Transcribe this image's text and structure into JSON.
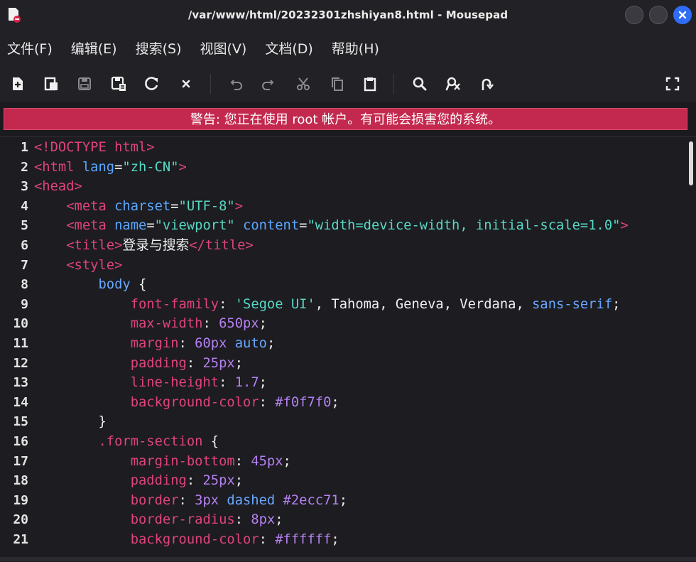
{
  "window": {
    "title": "/var/www/html/20232301zhshiyan8.html - Mousepad",
    "close_color": "#2f6df6"
  },
  "menu": [
    "文件(F)",
    "编辑(E)",
    "搜索(S)",
    "视图(V)",
    "文档(D)",
    "帮助(H)"
  ],
  "toolbar": {
    "icons": [
      "new-document-icon",
      "new-window-icon",
      "save-icon",
      "save-as-icon",
      "reload-icon",
      "close-tab-icon",
      "undo-icon",
      "redo-icon",
      "cut-icon",
      "copy-icon",
      "paste-icon",
      "search-icon",
      "replace-icon",
      "goto-line-icon",
      "fullscreen-icon"
    ]
  },
  "warning": {
    "text": "警告: 您正在使用 root 帐户。有可能会损害您的系统。",
    "color": "#c3294e"
  },
  "editor": {
    "line_numbers": [
      "1",
      "2",
      "3",
      "4",
      "5",
      "6",
      "7",
      "8",
      "9",
      "10",
      "11",
      "12",
      "13",
      "14",
      "15",
      "16",
      "17",
      "18",
      "19",
      "20",
      "21"
    ],
    "lines": [
      [
        {
          "t": "tag",
          "v": "<!DOCTYPE html>"
        }
      ],
      [
        {
          "t": "tag",
          "v": "<html "
        },
        {
          "t": "attr",
          "v": "lang"
        },
        {
          "t": "punc",
          "v": "="
        },
        {
          "t": "str",
          "v": "\"zh-CN\""
        },
        {
          "t": "tag",
          "v": ">"
        }
      ],
      [
        {
          "t": "tag",
          "v": "<head>"
        }
      ],
      [
        {
          "t": "punc",
          "v": "    "
        },
        {
          "t": "tag",
          "v": "<meta "
        },
        {
          "t": "attr",
          "v": "charset"
        },
        {
          "t": "punc",
          "v": "="
        },
        {
          "t": "str",
          "v": "\"UTF-8\""
        },
        {
          "t": "tag",
          "v": ">"
        }
      ],
      [
        {
          "t": "punc",
          "v": "    "
        },
        {
          "t": "tag",
          "v": "<meta "
        },
        {
          "t": "attr",
          "v": "name"
        },
        {
          "t": "punc",
          "v": "="
        },
        {
          "t": "str",
          "v": "\"viewport\" "
        },
        {
          "t": "attr",
          "v": "content"
        },
        {
          "t": "punc",
          "v": "="
        },
        {
          "t": "str",
          "v": "\"width=device-width, initial-scale=1.0\""
        },
        {
          "t": "tag",
          "v": ">"
        }
      ],
      [
        {
          "t": "punc",
          "v": "    "
        },
        {
          "t": "tag",
          "v": "<title>"
        },
        {
          "t": "txt",
          "v": "登录与搜索"
        },
        {
          "t": "tag",
          "v": "</title>"
        }
      ],
      [
        {
          "t": "punc",
          "v": "    "
        },
        {
          "t": "tag",
          "v": "<style>"
        }
      ],
      [
        {
          "t": "punc",
          "v": "        "
        },
        {
          "t": "sel",
          "v": "body"
        },
        {
          "t": "punc",
          "v": " {"
        }
      ],
      [
        {
          "t": "punc",
          "v": "            "
        },
        {
          "t": "prop",
          "v": "font-family"
        },
        {
          "t": "punc",
          "v": ": "
        },
        {
          "t": "str",
          "v": "'Segoe UI'"
        },
        {
          "t": "punc",
          "v": ", Tahoma, Geneva, Verdana, "
        },
        {
          "t": "kw",
          "v": "sans-serif"
        },
        {
          "t": "punc",
          "v": ";"
        }
      ],
      [
        {
          "t": "punc",
          "v": "            "
        },
        {
          "t": "prop",
          "v": "max-width"
        },
        {
          "t": "punc",
          "v": ": "
        },
        {
          "t": "num",
          "v": "650px"
        },
        {
          "t": "punc",
          "v": ";"
        }
      ],
      [
        {
          "t": "punc",
          "v": "            "
        },
        {
          "t": "prop",
          "v": "margin"
        },
        {
          "t": "punc",
          "v": ": "
        },
        {
          "t": "num",
          "v": "60px "
        },
        {
          "t": "kw",
          "v": "auto"
        },
        {
          "t": "punc",
          "v": ";"
        }
      ],
      [
        {
          "t": "punc",
          "v": "            "
        },
        {
          "t": "prop",
          "v": "padding"
        },
        {
          "t": "punc",
          "v": ": "
        },
        {
          "t": "num",
          "v": "25px"
        },
        {
          "t": "punc",
          "v": ";"
        }
      ],
      [
        {
          "t": "punc",
          "v": "            "
        },
        {
          "t": "prop",
          "v": "line-height"
        },
        {
          "t": "punc",
          "v": ": "
        },
        {
          "t": "num",
          "v": "1.7"
        },
        {
          "t": "punc",
          "v": ";"
        }
      ],
      [
        {
          "t": "punc",
          "v": "            "
        },
        {
          "t": "prop",
          "v": "background-color"
        },
        {
          "t": "punc",
          "v": ": "
        },
        {
          "t": "num",
          "v": "#f0f7f0"
        },
        {
          "t": "punc",
          "v": ";"
        }
      ],
      [
        {
          "t": "punc",
          "v": "        }"
        }
      ],
      [
        {
          "t": "punc",
          "v": "        "
        },
        {
          "t": "cls",
          "v": ".form-section"
        },
        {
          "t": "punc",
          "v": " {"
        }
      ],
      [
        {
          "t": "punc",
          "v": "            "
        },
        {
          "t": "prop",
          "v": "margin-bottom"
        },
        {
          "t": "punc",
          "v": ": "
        },
        {
          "t": "num",
          "v": "45px"
        },
        {
          "t": "punc",
          "v": ";"
        }
      ],
      [
        {
          "t": "punc",
          "v": "            "
        },
        {
          "t": "prop",
          "v": "padding"
        },
        {
          "t": "punc",
          "v": ": "
        },
        {
          "t": "num",
          "v": "25px"
        },
        {
          "t": "punc",
          "v": ";"
        }
      ],
      [
        {
          "t": "punc",
          "v": "            "
        },
        {
          "t": "prop",
          "v": "border"
        },
        {
          "t": "punc",
          "v": ": "
        },
        {
          "t": "num",
          "v": "3px "
        },
        {
          "t": "kw",
          "v": "dashed "
        },
        {
          "t": "num",
          "v": "#2ecc71"
        },
        {
          "t": "punc",
          "v": ";"
        }
      ],
      [
        {
          "t": "punc",
          "v": "            "
        },
        {
          "t": "prop",
          "v": "border-radius"
        },
        {
          "t": "punc",
          "v": ": "
        },
        {
          "t": "num",
          "v": "8px"
        },
        {
          "t": "punc",
          "v": ";"
        }
      ],
      [
        {
          "t": "punc",
          "v": "            "
        },
        {
          "t": "prop",
          "v": "background-color"
        },
        {
          "t": "punc",
          "v": ": "
        },
        {
          "t": "num",
          "v": "#ffffff"
        },
        {
          "t": "punc",
          "v": ";"
        }
      ]
    ]
  }
}
